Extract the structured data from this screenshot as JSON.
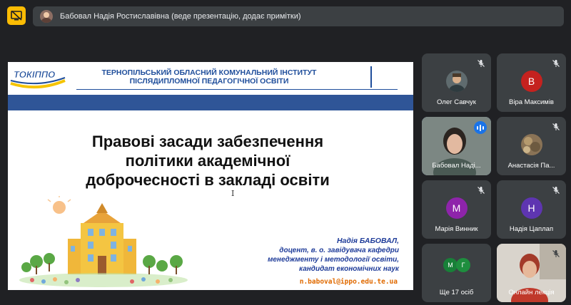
{
  "top_bar": {
    "presenter_text": "Бабовал Надія Ростиславівна (веде презентацію, додає примітки)"
  },
  "slide": {
    "logo_text": "ТОКІППО",
    "institute_lines": [
      "ТЕРНОПІЛЬСЬКИЙ ОБЛАСНИЙ КОМУНАЛЬНИЙ ІНСТИТУТ",
      "ПІСЛЯДИПЛОМНОЇ ПЕДАГОГІЧНОЇ ОСВІТИ"
    ],
    "title_lines": [
      "Правові засади забезпечення",
      "політики академічної",
      "доброчесності в закладі освіти"
    ],
    "cursor_glyph": "I",
    "author_name": "Надія БАБОВАЛ,",
    "author_lines": [
      "доцент, в. о. завідувача кафедри",
      "менеджменту  і методології освіти,",
      "кандидат економічних наук"
    ],
    "email": "n.baboval@ippo.edu.te.ua"
  },
  "participants": [
    {
      "name": "Олег Савчук",
      "type": "photo",
      "mic": "muted"
    },
    {
      "name": "Віра Максимів",
      "type": "initial",
      "initial": "В",
      "color": "#c5221f",
      "mic": "muted"
    },
    {
      "name": "Бабовал Наді...",
      "type": "video",
      "mic": "speaking"
    },
    {
      "name": "Анастасія Па...",
      "type": "photo",
      "mic": "muted"
    },
    {
      "name": "Марія Винник",
      "type": "initial",
      "initial": "М",
      "color": "#8e24aa",
      "mic": "muted"
    },
    {
      "name": "Надія Цаплап",
      "type": "initial",
      "initial": "Н",
      "color": "#5e35b1",
      "mic": "muted"
    },
    {
      "name": "Ще 17 осіб",
      "type": "group",
      "initials": [
        "М",
        "Г"
      ],
      "colors": [
        "#188038",
        "#1e8e3e"
      ]
    },
    {
      "name": "Онлайн лекція",
      "type": "video",
      "mic": "muted"
    }
  ],
  "colors": {
    "background": "#202124",
    "tile": "#3c4043",
    "accent_yellow": "#fbbc04",
    "speaking_blue": "#1a73e8",
    "slide_blue": "#2f5597"
  }
}
